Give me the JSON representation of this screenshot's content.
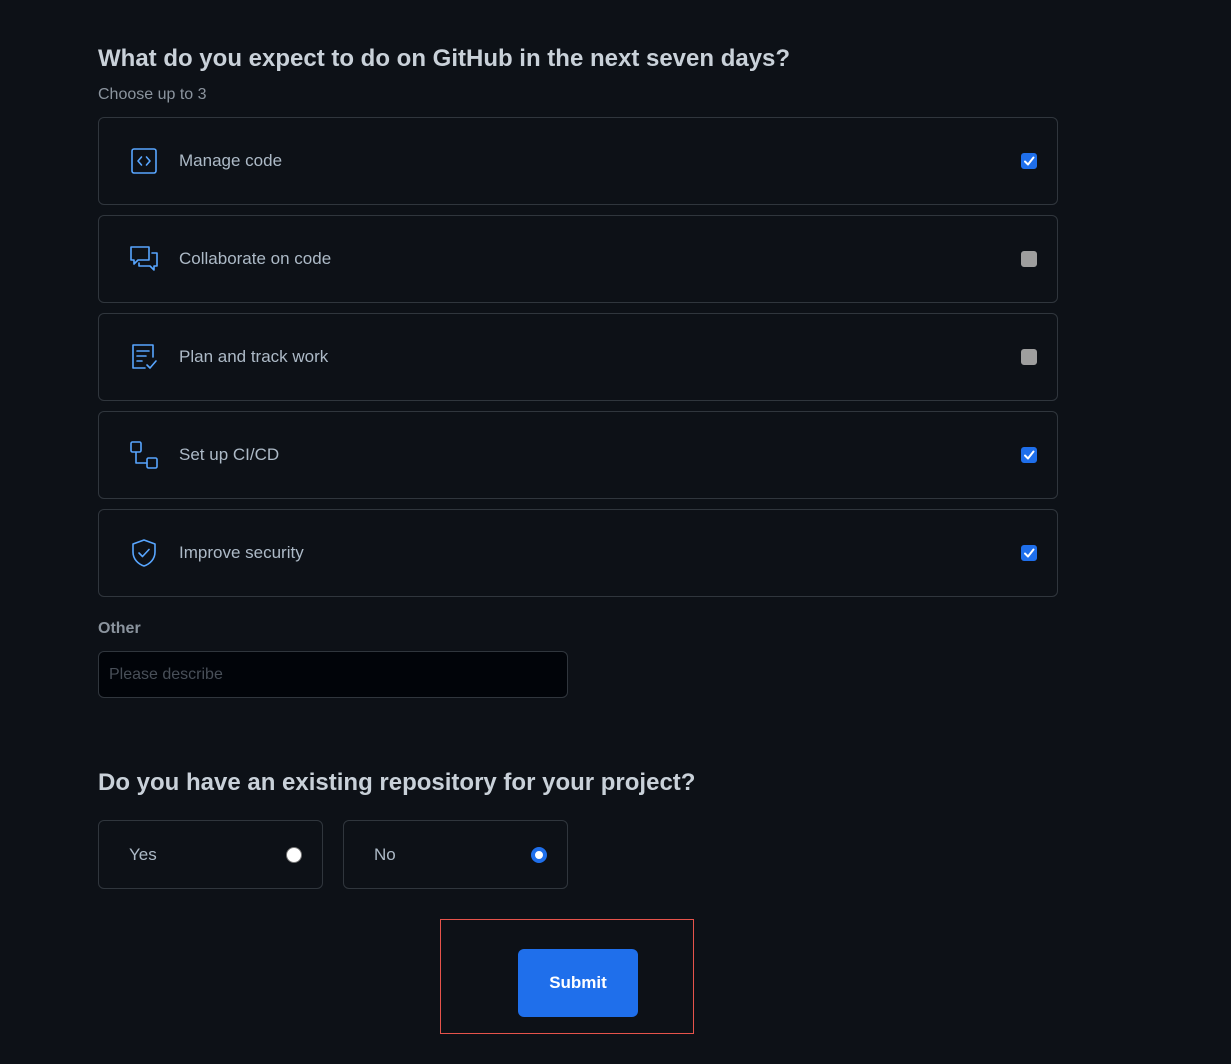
{
  "question1": {
    "title": "What do you expect to do on GitHub in the next seven days?",
    "subtitle": "Choose up to 3",
    "options": [
      {
        "label": "Manage code",
        "icon": "code-square-icon",
        "checked": true
      },
      {
        "label": "Collaborate on code",
        "icon": "comment-discussion-icon",
        "checked": false
      },
      {
        "label": "Plan and track work",
        "icon": "checklist-icon",
        "checked": false
      },
      {
        "label": "Set up CI/CD",
        "icon": "workflow-icon",
        "checked": true
      },
      {
        "label": "Improve security",
        "icon": "shield-check-icon",
        "checked": true
      }
    ],
    "other": {
      "label": "Other",
      "placeholder": "Please describe",
      "value": ""
    }
  },
  "question2": {
    "title": "Do you have an existing repository for your project?",
    "options": [
      {
        "label": "Yes",
        "selected": false
      },
      {
        "label": "No",
        "selected": true
      }
    ]
  },
  "submit": {
    "label": "Submit"
  },
  "colors": {
    "background": "#0d1117",
    "accent": "#1f6feb",
    "icon": "#58a6ff",
    "border": "#30363d",
    "highlight_frame": "#e5534b"
  }
}
